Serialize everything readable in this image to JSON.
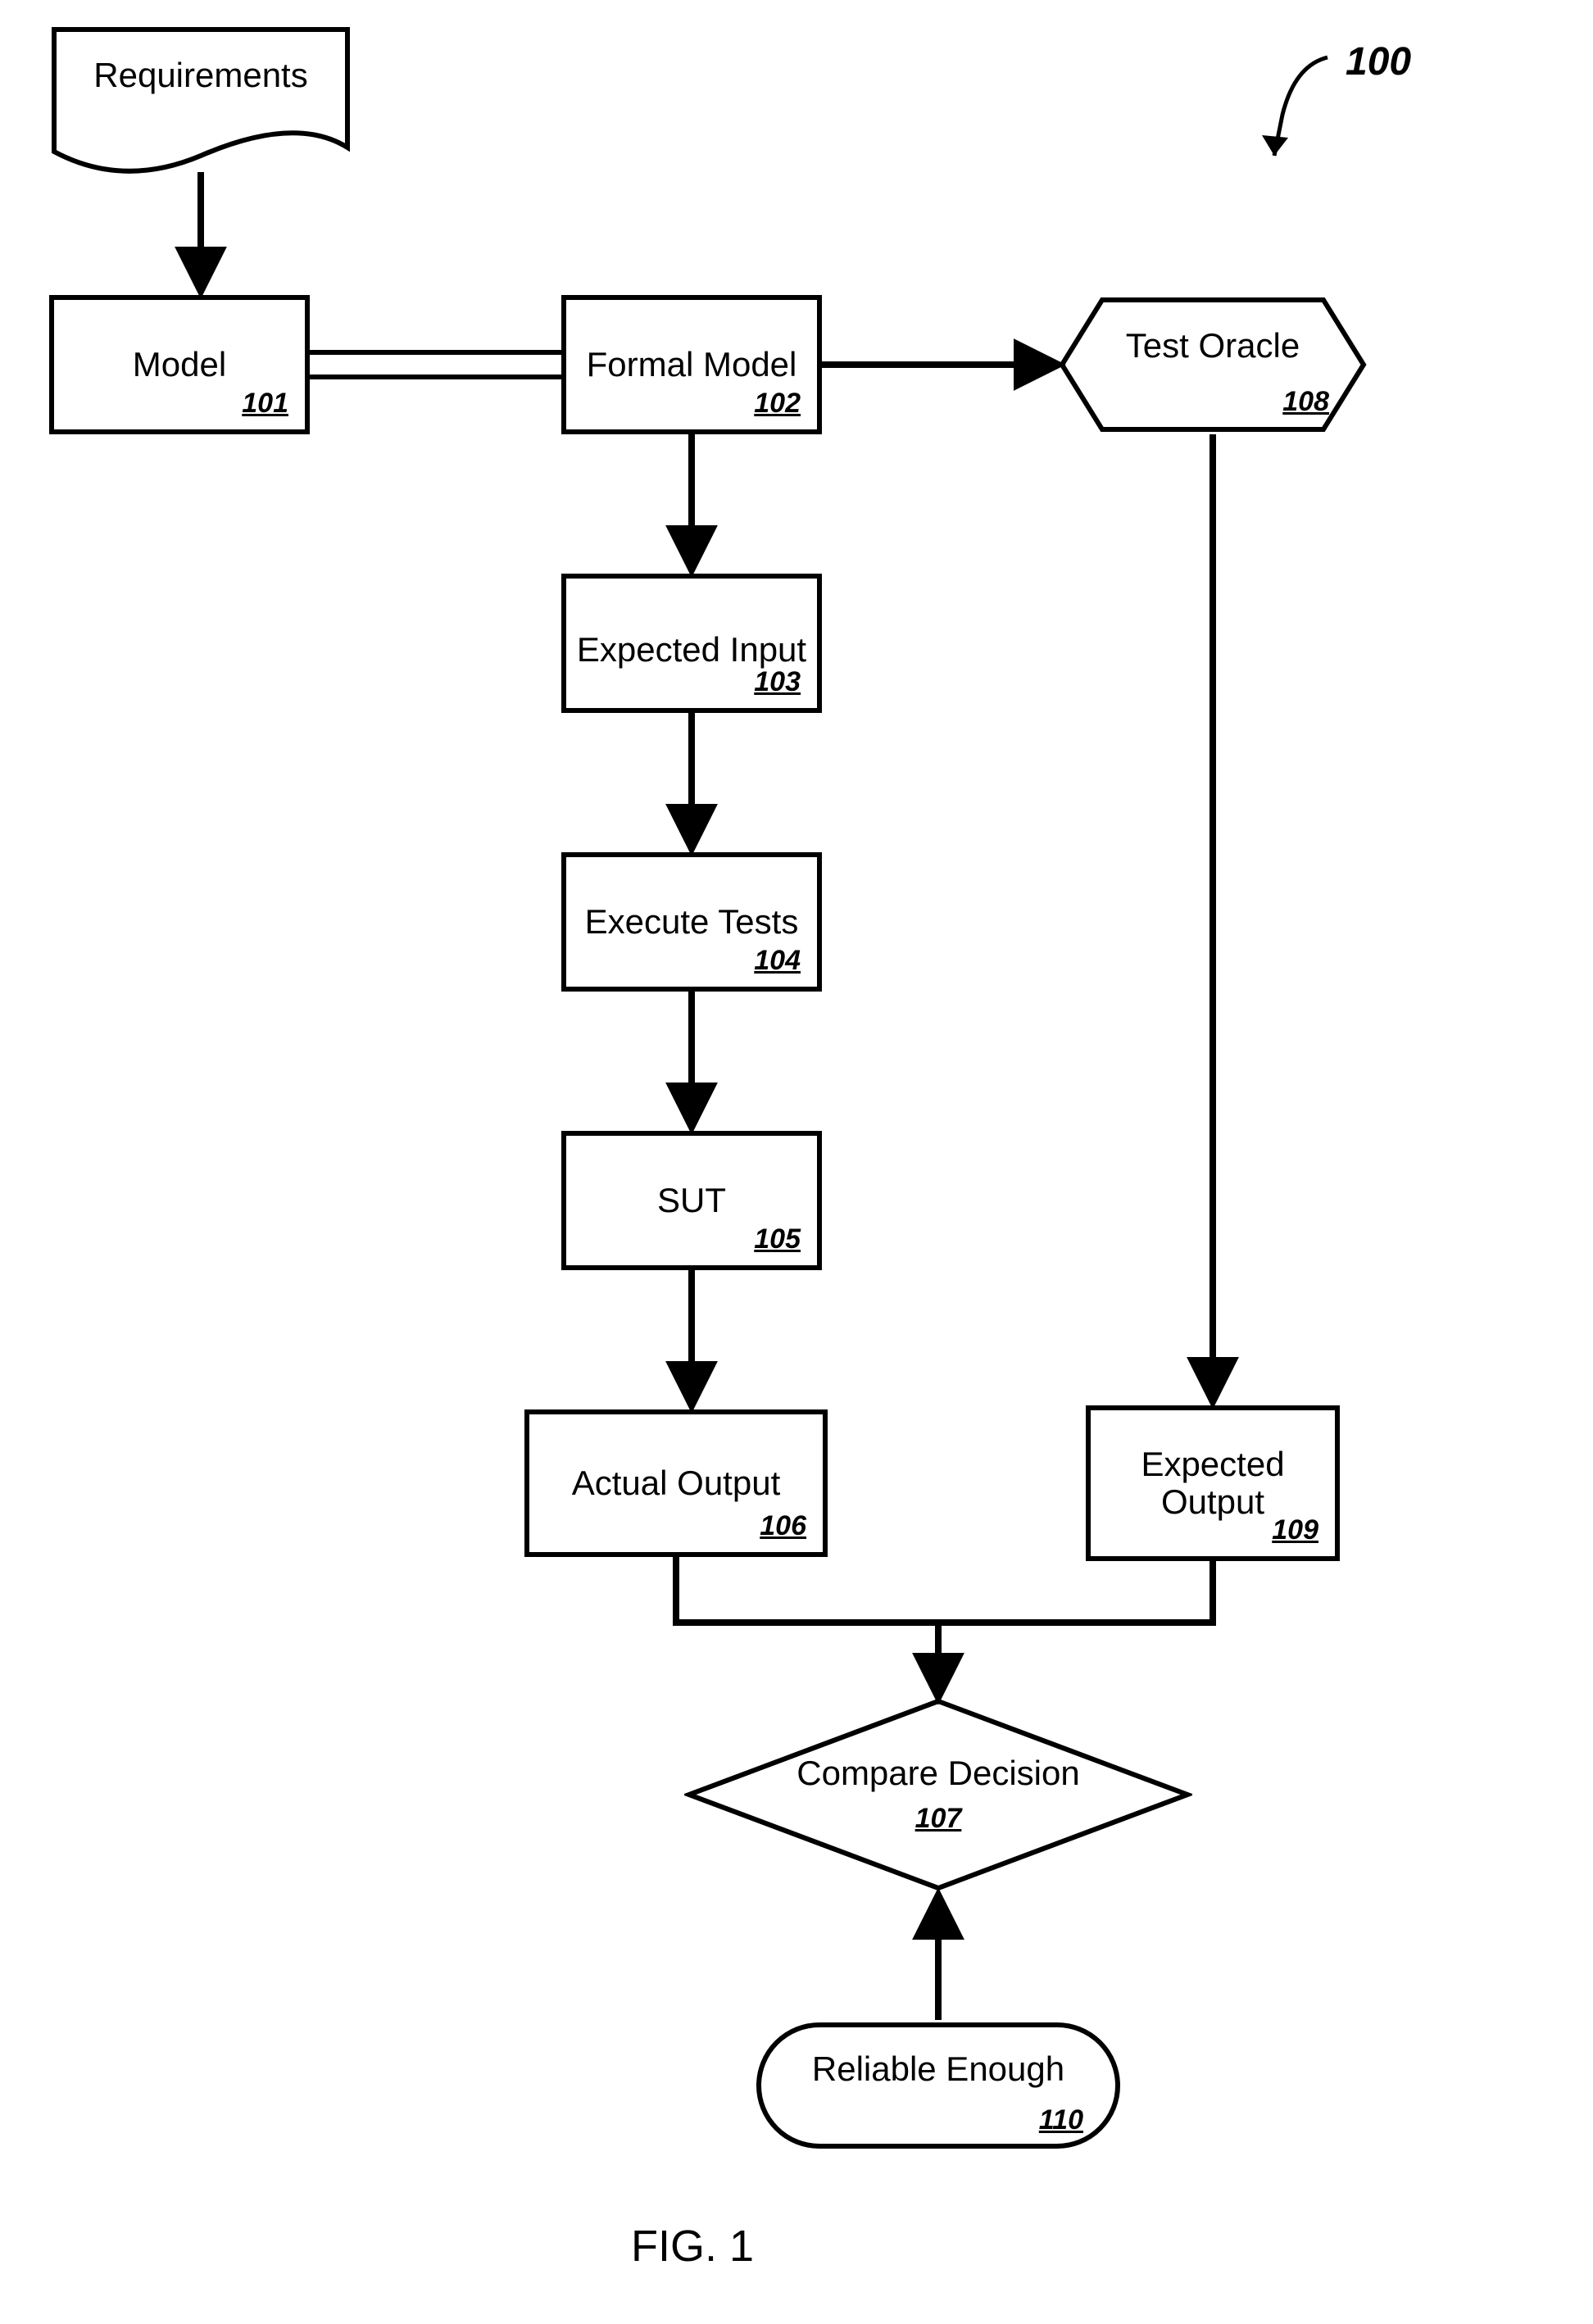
{
  "figure_ref": "100",
  "figure_caption": "FIG. 1",
  "nodes": {
    "requirements": {
      "label": "Requirements"
    },
    "model": {
      "label": "Model",
      "ref": "101"
    },
    "formal_model": {
      "label": "Formal Model",
      "ref": "102"
    },
    "expected_input": {
      "label": "Expected Input",
      "ref": "103"
    },
    "execute_tests": {
      "label": "Execute Tests",
      "ref": "104"
    },
    "sut": {
      "label": "SUT",
      "ref": "105"
    },
    "actual_output": {
      "label": "Actual Output",
      "ref": "106"
    },
    "compare_decision": {
      "label": "Compare Decision",
      "ref": "107"
    },
    "test_oracle": {
      "label": "Test Oracle",
      "ref": "108"
    },
    "expected_output_label1": "Expected",
    "expected_output_label2": "Output",
    "expected_output_ref": "109",
    "reliable_enough": {
      "label": "Reliable Enough",
      "ref": "110"
    }
  }
}
